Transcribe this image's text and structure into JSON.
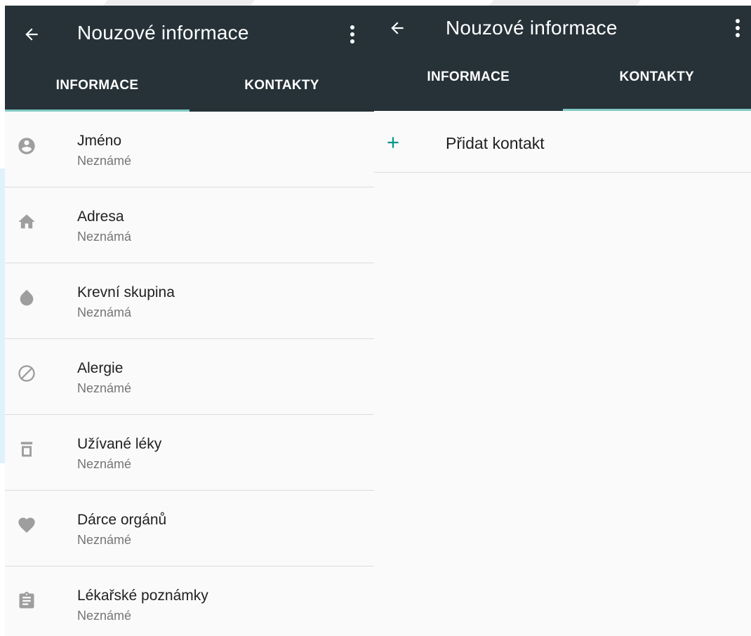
{
  "left_screen": {
    "title": "Nouzové informace",
    "tabs": [
      {
        "label": "INFORMACE",
        "selected": true
      },
      {
        "label": "KONTAKTY",
        "selected": false
      }
    ],
    "items": [
      {
        "icon": "person-icon",
        "title": "Jméno",
        "value": "Neznámé"
      },
      {
        "icon": "home-icon",
        "title": "Adresa",
        "value": "Neznámá"
      },
      {
        "icon": "blood-drop-icon",
        "title": "Krevní skupina",
        "value": "Neznámá"
      },
      {
        "icon": "block-icon",
        "title": "Alergie",
        "value": "Neznámé"
      },
      {
        "icon": "pill-bottle-icon",
        "title": "Užívané léky",
        "value": "Neznámé"
      },
      {
        "icon": "heart-icon",
        "title": "Dárce orgánů",
        "value": "Neznámé"
      },
      {
        "icon": "clipboard-icon",
        "title": "Lékařské poznámky",
        "value": "Neznámé"
      }
    ]
  },
  "right_screen": {
    "title": "Nouzové informace",
    "tabs": [
      {
        "label": "INFORMACE",
        "selected": false
      },
      {
        "label": "KONTAKTY",
        "selected": true
      }
    ],
    "add_contact_label": "Přidat kontakt"
  },
  "colors": {
    "app_bar": "#263238",
    "tab_indicator": "#80cbc4",
    "accent": "#009688",
    "icon_gray": "#9e9e9e",
    "background": "#fafafa"
  }
}
